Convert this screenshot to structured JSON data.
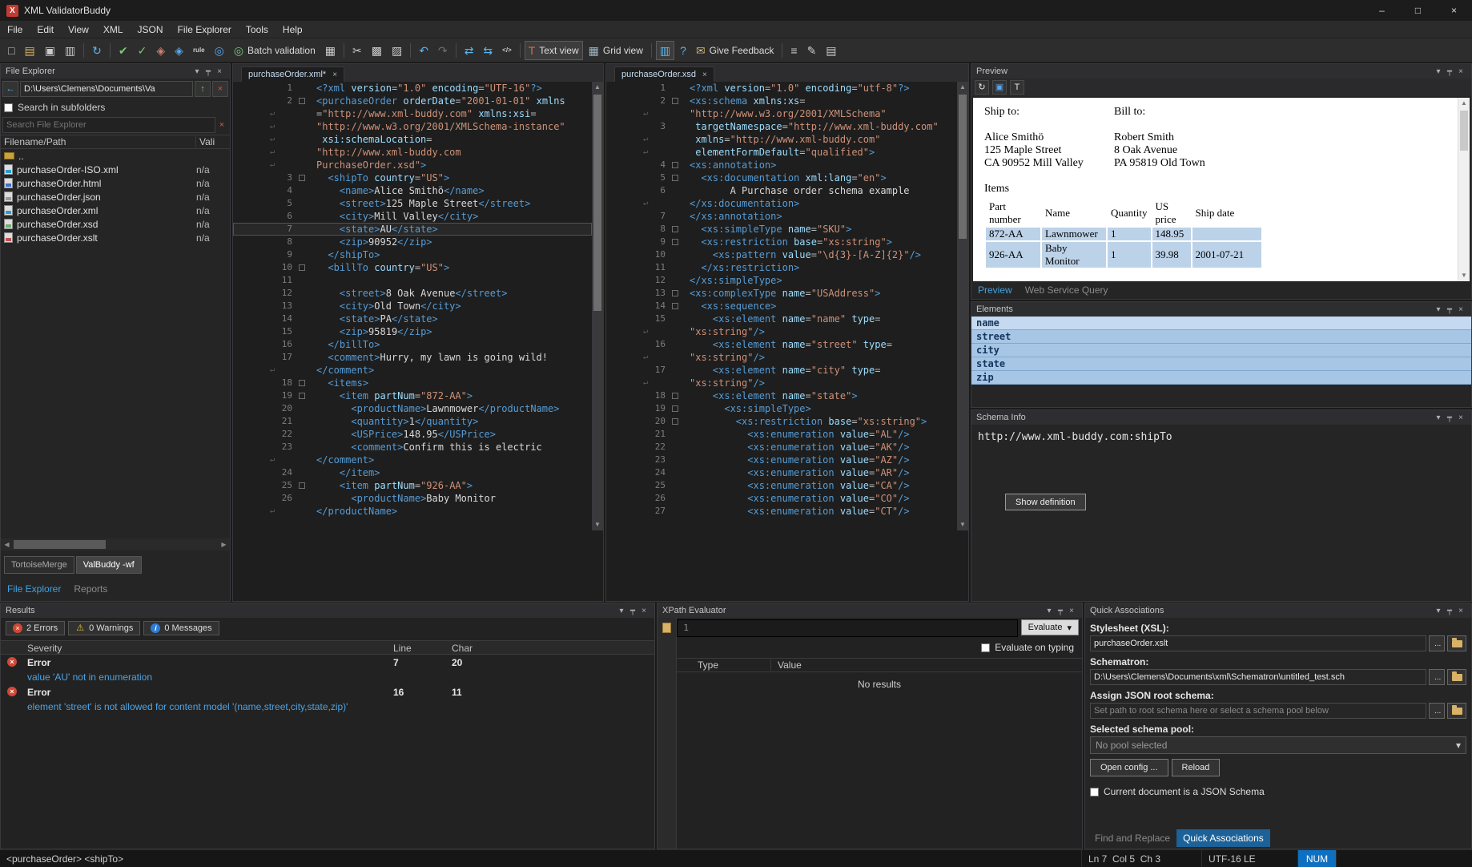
{
  "icons": {
    "close": "×",
    "chevron": "▾",
    "pin": "┯",
    "up": "▲",
    "down": "▼",
    "left": "◀",
    "right": "▶",
    "back": "←",
    "up_arrow": "↑",
    "warning": "⚠",
    "info": "i",
    "wrap": "↵"
  },
  "window": {
    "title": "XML ValidatorBuddy",
    "minimize": "–",
    "maximize": "□",
    "close": "×"
  },
  "menu": {
    "items": [
      "File",
      "Edit",
      "View",
      "XML",
      "JSON",
      "File Explorer",
      "Tools",
      "Help"
    ]
  },
  "toolbar": {
    "buttons": [
      {
        "name": "new-file",
        "glyph": "□",
        "color": "#cccccc"
      },
      {
        "name": "open-file",
        "glyph": "▤",
        "color": "#d8b266"
      },
      {
        "name": "save",
        "glyph": "▣",
        "color": "#cccccc"
      },
      {
        "name": "print",
        "glyph": "▥",
        "color": "#cccccc"
      },
      {
        "sep": true
      },
      {
        "name": "refresh",
        "glyph": "↻",
        "color": "#58b6f0"
      },
      {
        "sep": true
      },
      {
        "name": "validate-document",
        "glyph": "✔",
        "color": "#7bc87b"
      },
      {
        "name": "check-well-formed",
        "glyph": "✓",
        "color": "#7bc87b"
      },
      {
        "name": "validate-schema",
        "glyph": "◈",
        "color": "#d97b6c"
      },
      {
        "name": "assign-schema",
        "glyph": "◈",
        "color": "#58a6e8"
      },
      {
        "name": "rule",
        "glyph": "rule",
        "color": "#cccccc",
        "small": true
      },
      {
        "name": "globe",
        "glyph": "◎",
        "color": "#58a6e8"
      },
      {
        "name": "batch-validation",
        "glyph": "◎",
        "color": "#7bc87b",
        "label": "Batch validation"
      },
      {
        "name": "grid",
        "glyph": "▦",
        "color": "#cccccc"
      },
      {
        "sep": true
      },
      {
        "name": "cut",
        "glyph": "✂",
        "color": "#cccccc"
      },
      {
        "name": "copy",
        "glyph": "▩",
        "color": "#cccccc"
      },
      {
        "name": "paste",
        "glyph": "▨",
        "color": "#cccccc"
      },
      {
        "sep": true
      },
      {
        "name": "undo",
        "glyph": "↶",
        "color": "#58b6f0"
      },
      {
        "name": "redo",
        "glyph": "↷",
        "color": "#6e6e6e"
      },
      {
        "sep": true
      },
      {
        "name": "compare-files",
        "glyph": "⇄",
        "color": "#58b6f0"
      },
      {
        "name": "merge-files",
        "glyph": "⇆",
        "color": "#58b6f0"
      },
      {
        "name": "code-snippet",
        "glyph": "</>",
        "color": "#cccccc",
        "small": true
      },
      {
        "sep": true
      },
      {
        "name": "text-view",
        "glyph": "T",
        "color": "#e0684a",
        "label": "Text view",
        "pressed": true
      },
      {
        "name": "grid-view",
        "glyph": "▦",
        "color": "#9fb6c4",
        "label": "Grid view"
      },
      {
        "sep": true
      },
      {
        "name": "column-mode",
        "glyph": "▥",
        "color": "#58b6f0",
        "pressed": true
      },
      {
        "name": "help",
        "glyph": "?",
        "color": "#58b6f0"
      },
      {
        "name": "give-feedback",
        "glyph": "✉",
        "color": "#d8b266",
        "label": "Give Feedback"
      },
      {
        "sep": true
      },
      {
        "name": "console",
        "glyph": "≡",
        "color": "#cccccc"
      },
      {
        "name": "edit-document",
        "glyph": "✎",
        "color": "#cccccc"
      },
      {
        "name": "export",
        "glyph": "▤",
        "color": "#cccccc"
      }
    ]
  },
  "file_explorer": {
    "title": "File Explorer",
    "path": "D:\\Users\\Clemens\\Documents\\Va",
    "search_subfolders_label": "Search in subfolders",
    "search_placeholder": "Search File Explorer",
    "columns": [
      "Filename/Path",
      "Vali"
    ],
    "files": [
      {
        "icon": "folder",
        "name": "..",
        "vali": ""
      },
      {
        "icon": "xml",
        "name": "purchaseOrder-ISO.xml",
        "vali": "n/a"
      },
      {
        "icon": "html",
        "name": "purchaseOrder.html",
        "vali": "n/a"
      },
      {
        "icon": "json",
        "name": "purchaseOrder.json",
        "vali": "n/a"
      },
      {
        "icon": "xml",
        "name": "purchaseOrder.xml",
        "vali": "n/a"
      },
      {
        "icon": "xsd",
        "name": "purchaseOrder.xsd",
        "vali": "n/a"
      },
      {
        "icon": "xslt",
        "name": "purchaseOrder.xslt",
        "vali": "n/a"
      }
    ],
    "view_buttons": [
      {
        "label": "TortoiseMerge",
        "active": false
      },
      {
        "label": "ValBuddy -wf",
        "active": true
      }
    ],
    "tabs": [
      {
        "label": "File Explorer",
        "active": true
      },
      {
        "label": "Reports",
        "active": false
      }
    ]
  },
  "editor_xml": {
    "tab": "purchaseOrder.xml*",
    "rows": [
      {
        "n": "1",
        "t": "<?xml version=\"1.0\" encoding=\"UTF-16\"?>"
      },
      {
        "n": "2",
        "f": 1,
        "t": "<purchaseOrder orderDate=\"2001-01-01\" xmlns"
      },
      {
        "t": "=\"http://www.xml-buddy.com\" xmlns:xsi="
      },
      {
        "t": "\"http://www.w3.org/2001/XMLSchema-instance\""
      },
      {
        "t": " xsi:schemaLocation="
      },
      {
        "t": "\"http://www.xml-buddy.com"
      },
      {
        "t": "PurchaseOrder.xsd\">"
      },
      {
        "n": "3",
        "f": 1,
        "t": "  <shipTo country=\"US\">"
      },
      {
        "n": "4",
        "t": "    <name>Alice Smithö</name>"
      },
      {
        "n": "5",
        "t": "    <street>125 Maple Street</street>"
      },
      {
        "n": "6",
        "t": "    <city>Mill Valley</city>"
      },
      {
        "n": "7",
        "c": 1,
        "t": "    <state>AU</state>"
      },
      {
        "n": "8",
        "t": "    <zip>90952</zip>"
      },
      {
        "n": "9",
        "t": "  </shipTo>"
      },
      {
        "n": "10",
        "f": 1,
        "t": "  <billTo country=\"US\">"
      },
      {
        "n": "11",
        "t": ""
      },
      {
        "n": "12",
        "t": "    <street>8 Oak Avenue</street>"
      },
      {
        "n": "13",
        "t": "    <city>Old Town</city>"
      },
      {
        "n": "14",
        "t": "    <state>PA</state>"
      },
      {
        "n": "15",
        "t": "    <zip>95819</zip>"
      },
      {
        "n": "16",
        "t": "  </billTo>"
      },
      {
        "n": "17",
        "t": "  <comment>Hurry, my lawn is going wild!"
      },
      {
        "t": "</comment>"
      },
      {
        "n": "18",
        "f": 1,
        "t": "  <items>"
      },
      {
        "n": "19",
        "f": 1,
        "t": "    <item partNum=\"872-AA\">"
      },
      {
        "n": "20",
        "t": "      <productName>Lawnmower</productName>"
      },
      {
        "n": "21",
        "t": "      <quantity>1</quantity>"
      },
      {
        "n": "22",
        "t": "      <USPrice>148.95</USPrice>"
      },
      {
        "n": "23",
        "t": "      <comment>Confirm this is electric"
      },
      {
        "t": "</comment>"
      },
      {
        "n": "24",
        "t": "    </item>"
      },
      {
        "n": "25",
        "f": 1,
        "t": "    <item partNum=\"926-AA\">"
      },
      {
        "n": "26",
        "t": "      <productName>Baby Monitor"
      },
      {
        "t": "</productName>"
      }
    ]
  },
  "editor_xsd": {
    "tab": "purchaseOrder.xsd",
    "rows": [
      {
        "n": "1",
        "t": "<?xml version=\"1.0\" encoding=\"utf-8\"?>"
      },
      {
        "n": "2",
        "f": 1,
        "t": "<xs:schema xmlns:xs="
      },
      {
        "t": "\"http://www.w3.org/2001/XMLSchema\""
      },
      {
        "n": "3",
        "t": " targetNamespace=\"http://www.xml-buddy.com\""
      },
      {
        "t": " xmlns=\"http://www.xml-buddy.com\""
      },
      {
        "t": " elementFormDefault=\"qualified\">"
      },
      {
        "n": "4",
        "f": 1,
        "t": "<xs:annotation>"
      },
      {
        "n": "5",
        "f": 1,
        "t": "  <xs:documentation xml:lang=\"en\">"
      },
      {
        "n": "6",
        "t": "       A Purchase order schema example"
      },
      {
        "t": "</xs:documentation>"
      },
      {
        "n": "7",
        "t": "</xs:annotation>"
      },
      {
        "n": "8",
        "f": 1,
        "t": "  <xs:simpleType name=\"SKU\">"
      },
      {
        "n": "9",
        "f": 1,
        "t": "  <xs:restriction base=\"xs:string\">"
      },
      {
        "n": "10",
        "t": "    <xs:pattern value=\"\\d{3}-[A-Z]{2}\"/>"
      },
      {
        "n": "11",
        "t": "  </xs:restriction>"
      },
      {
        "n": "12",
        "t": "</xs:simpleType>"
      },
      {
        "n": "13",
        "f": 1,
        "t": "<xs:complexType name=\"USAddress\">"
      },
      {
        "n": "14",
        "f": 1,
        "t": "  <xs:sequence>"
      },
      {
        "n": "15",
        "t": "    <xs:element name=\"name\" type="
      },
      {
        "t": "\"xs:string\"/>"
      },
      {
        "n": "16",
        "t": "    <xs:element name=\"street\" type="
      },
      {
        "t": "\"xs:string\"/>"
      },
      {
        "n": "17",
        "t": "    <xs:element name=\"city\" type="
      },
      {
        "t": "\"xs:string\"/>"
      },
      {
        "n": "18",
        "f": 1,
        "t": "    <xs:element name=\"state\">"
      },
      {
        "n": "19",
        "f": 1,
        "t": "      <xs:simpleType>"
      },
      {
        "n": "20",
        "f": 1,
        "t": "        <xs:restriction base=\"xs:string\">"
      },
      {
        "n": "21",
        "t": "          <xs:enumeration value=\"AL\"/>"
      },
      {
        "n": "22",
        "t": "          <xs:enumeration value=\"AK\"/>"
      },
      {
        "n": "23",
        "t": "          <xs:enumeration value=\"AZ\"/>"
      },
      {
        "n": "24",
        "t": "          <xs:enumeration value=\"AR\"/>"
      },
      {
        "n": "25",
        "t": "          <xs:enumeration value=\"CA\"/>"
      },
      {
        "n": "26",
        "t": "          <xs:enumeration value=\"CO\"/>"
      },
      {
        "n": "27",
        "t": "          <xs:enumeration value=\"CT\"/>"
      }
    ]
  },
  "preview": {
    "title": "Preview",
    "toolbar_icons": [
      {
        "name": "refresh",
        "glyph": "↻",
        "color": "#e8e8e8"
      },
      {
        "name": "stylesheet",
        "glyph": "▣",
        "color": "#58a6e8"
      },
      {
        "name": "font",
        "glyph": "T",
        "color": "#e8e8e8"
      }
    ],
    "ship_to_label": "Ship to:",
    "bill_to_label": "Bill to:",
    "ship_to": [
      "Alice Smithö",
      "125 Maple Street",
      "CA 90952 Mill Valley"
    ],
    "bill_to": [
      "Robert Smith",
      "8 Oak Avenue",
      "PA 95819 Old Town"
    ],
    "items_label": "Items",
    "table": {
      "columns": [
        "Part number",
        "Name",
        "Quantity",
        "US price",
        "Ship date"
      ],
      "rows": [
        [
          "872-AA",
          "Lawnmower",
          "1",
          "148.95",
          ""
        ],
        [
          "926-AA",
          "Baby Monitor",
          "1",
          "39.98",
          "2001-07-21"
        ]
      ]
    },
    "tabs": [
      {
        "label": "Preview",
        "active": true
      },
      {
        "label": "Web Service Query",
        "active": false
      }
    ]
  },
  "elements_panel": {
    "title": "Elements",
    "items": [
      "name",
      "street",
      "city",
      "state",
      "zip"
    ]
  },
  "schema_info": {
    "title": "Schema Info",
    "definition": "http://www.xml-buddy.com:shipTo",
    "show_definition_button": "Show definition"
  },
  "results": {
    "title": "Results",
    "filters": [
      {
        "icon": "err",
        "label": "2 Errors"
      },
      {
        "icon": "warn",
        "label": "0 Warnings"
      },
      {
        "icon": "info",
        "label": "0 Messages"
      }
    ],
    "columns": [
      "Severity",
      "Line",
      "Char"
    ],
    "rows": [
      {
        "severity": "Error",
        "line": "7",
        "char": "20",
        "detail": "value 'AU' not in enumeration"
      },
      {
        "severity": "Error",
        "line": "16",
        "char": "11",
        "detail": "element 'street' is not allowed for content model '(name,street,city,state,zip)'"
      }
    ]
  },
  "xpath": {
    "title": "XPath Evaluator",
    "line_number": "1",
    "evaluate_button": "Evaluate",
    "evaluate_on_typing_label": "Evaluate on typing",
    "columns": [
      "Type",
      "Value"
    ],
    "no_results_text": "No results"
  },
  "quick_assoc": {
    "title": "Quick Associations",
    "stylesheet_label": "Stylesheet (XSL):",
    "stylesheet_value": "purchaseOrder.xslt",
    "schematron_label": "Schematron:",
    "schematron_value": "D:\\Users\\Clemens\\Documents\\xml\\Schematron\\untitled_test.sch",
    "json_schema_label": "Assign JSON root schema:",
    "json_schema_placeholder": "Set path to root schema here or select a schema pool below",
    "pool_label": "Selected schema pool:",
    "pool_value": "No pool selected",
    "open_config_button": "Open config ...",
    "reload_button": "Reload",
    "json_checkbox_label": "Current document is a JSON Schema",
    "browse_label": "...",
    "tabs": [
      {
        "label": "Find and Replace",
        "active": false
      },
      {
        "label": "Quick Associations",
        "active": true
      }
    ]
  },
  "statusbar": {
    "context": "<purchaseOrder> <shipTo>",
    "position": "Ln 7  Col 5  Ch 3",
    "encoding": "UTF-16 LE",
    "numlock": "NUM"
  }
}
